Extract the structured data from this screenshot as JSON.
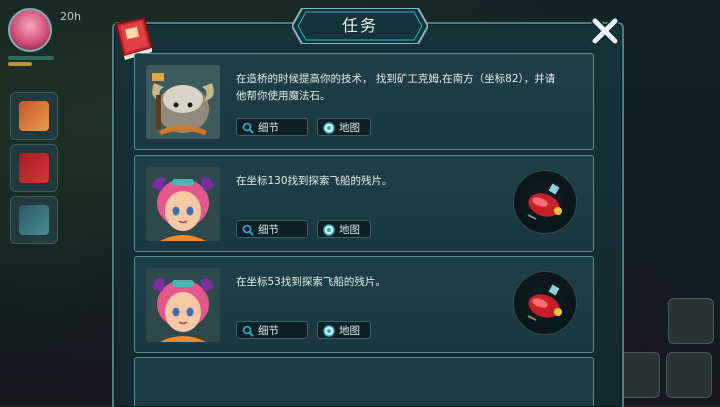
{
  "hud": {
    "timer": "20h"
  },
  "window": {
    "title": "任务"
  },
  "quests": [
    {
      "description": "在造桥的时候提高你的技术， 找到矿工克姆,在南方（坐标82），并请他帮你使用魔法石。",
      "detail_label": "细节",
      "map_label": "地图",
      "portrait": "miner-yak-portrait",
      "has_reward": false
    },
    {
      "description": "在坐标130找到探索飞船的残片。",
      "detail_label": "细节",
      "map_label": "地图",
      "portrait": "pink-hair-girl-portrait",
      "has_reward": true,
      "reward_icon": "ship-fragment-icon"
    },
    {
      "description": "在坐标53找到探索飞船的残片。",
      "detail_label": "细节",
      "map_label": "地图",
      "portrait": "pink-hair-girl-portrait",
      "has_reward": true,
      "reward_icon": "ship-fragment-icon"
    }
  ],
  "colors": {
    "panel": "#16333a",
    "border": "#5b8c92",
    "accent": "#2bb3c9",
    "text": "#e4ecec"
  }
}
